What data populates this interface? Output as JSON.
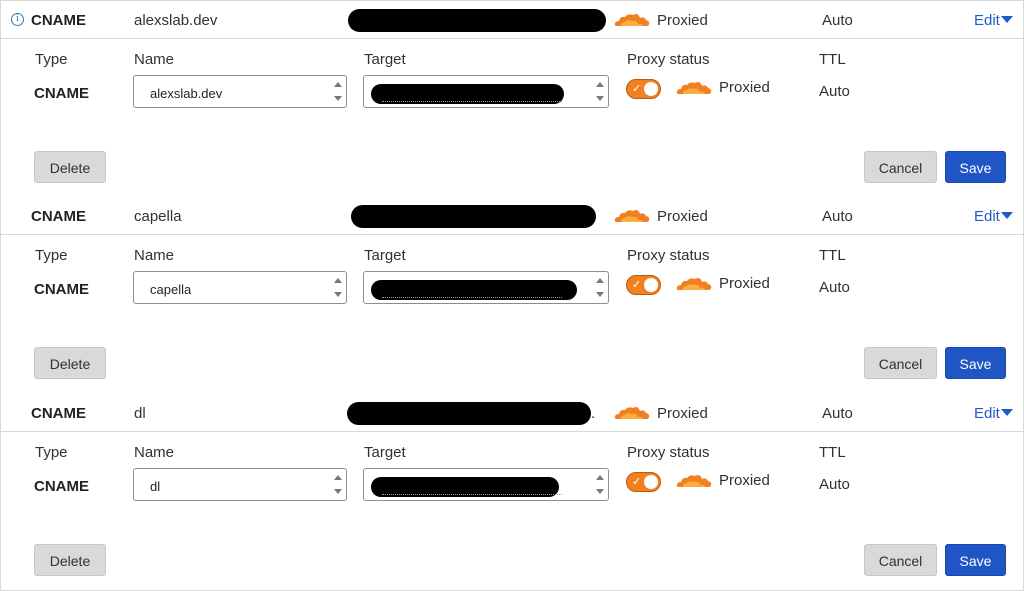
{
  "columns": {
    "type": "Type",
    "name": "Name",
    "target": "Target",
    "proxy_status": "Proxy status",
    "ttl": "TTL"
  },
  "buttons": {
    "delete": "Delete",
    "cancel": "Cancel",
    "save": "Save",
    "edit": "Edit"
  },
  "icons": {
    "info": "info-circle-icon",
    "cloud": "orange-cloud-icon",
    "check": "check-icon",
    "caret": "caret-down-icon"
  },
  "colors": {
    "cloud": "#f38020",
    "link": "#1f5bc5",
    "save": "#1f55c5"
  },
  "records": [
    {
      "type": "CNAME",
      "name": "alexslab.dev",
      "target_redacted": true,
      "proxy_status": "Proxied",
      "proxy_enabled": true,
      "ttl": "Auto",
      "name_field_value": "alexslab.dev"
    },
    {
      "type": "CNAME",
      "name": "capella",
      "target_redacted": true,
      "proxy_status": "Proxied",
      "proxy_enabled": true,
      "ttl": "Auto",
      "name_field_value": "capella"
    },
    {
      "type": "CNAME",
      "name": "dl",
      "target_redacted": true,
      "target_trailing": ".",
      "proxy_status": "Proxied",
      "proxy_enabled": true,
      "ttl": "Auto",
      "name_field_value": "dl"
    }
  ]
}
